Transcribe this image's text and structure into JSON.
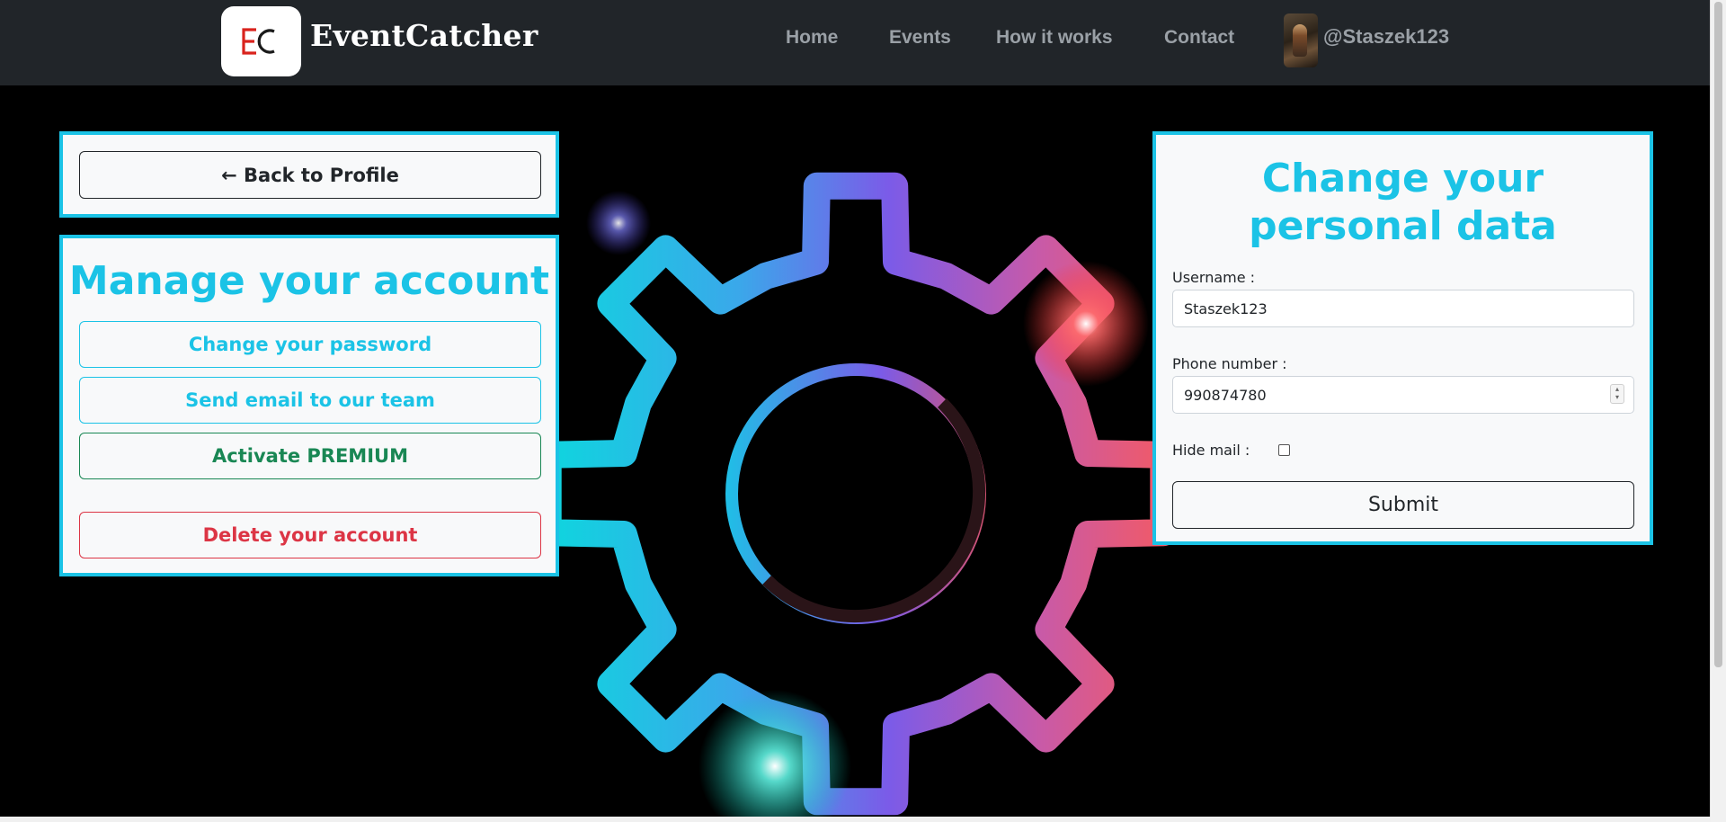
{
  "navbar": {
    "logo_text": "EC",
    "brand": "EventCatcher",
    "links": [
      "Home",
      "Events",
      "How it works",
      "Contact"
    ],
    "user": "@Staszek123"
  },
  "left": {
    "back_button": "← Back to Profile",
    "manage_title": "Manage your account",
    "change_password": "Change your password",
    "send_email": "Send email to our team",
    "activate_premium": "Activate PREMIUM",
    "delete_account": "Delete your account"
  },
  "right": {
    "title": "Change your personal data",
    "username_label": "Username :",
    "username_value": "Staszek123",
    "phone_label": "Phone number :",
    "phone_value": "990874780",
    "hide_mail_label": "Hide mail :",
    "hide_mail_checked": false,
    "submit": "Submit"
  },
  "colors": {
    "accent": "#1bc3e6",
    "premium": "#198754",
    "danger": "#dc3545",
    "navbar": "#212529"
  },
  "icons": {
    "background": "gear-icon"
  }
}
